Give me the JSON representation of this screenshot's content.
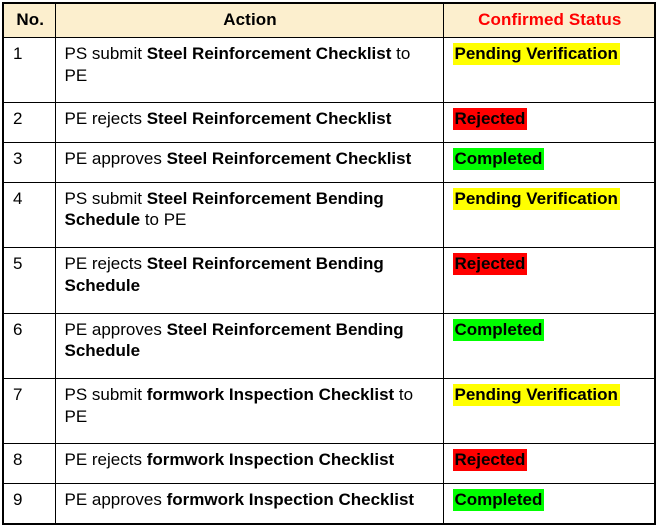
{
  "table": {
    "columns": [
      {
        "key": "no",
        "label": "No."
      },
      {
        "key": "action",
        "label": "Action"
      },
      {
        "key": "status",
        "label": "Confirmed Status"
      }
    ],
    "header_background": "#FCEFCE",
    "header_status_color": "#FF0000",
    "status_colors": {
      "pending": "#FFFF00",
      "rejected": "#FF0000",
      "completed": "#00FF00"
    },
    "rows": [
      {
        "no": "1",
        "action_prefix": "PS submit ",
        "action_bold": "Steel Reinforcement Checklist",
        "action_suffix": " to PE",
        "status": "Pending Verification",
        "status_kind": "pending"
      },
      {
        "no": "2",
        "action_prefix": "PE rejects ",
        "action_bold": "Steel Reinforcement Checklist",
        "action_suffix": "",
        "status": "Rejected",
        "status_kind": "rejected"
      },
      {
        "no": "3",
        "action_prefix": "PE approves ",
        "action_bold": "Steel Reinforcement Checklist",
        "action_suffix": "",
        "status": "Completed",
        "status_kind": "completed"
      },
      {
        "no": "4",
        "action_prefix": "PS submit ",
        "action_bold": "Steel Reinforcement Bending Schedule",
        "action_suffix": " to PE",
        "status": "Pending Verification",
        "status_kind": "pending"
      },
      {
        "no": "5",
        "action_prefix": "PE rejects ",
        "action_bold": "Steel Reinforcement Bending Schedule",
        "action_suffix": "",
        "status": "Rejected",
        "status_kind": "rejected"
      },
      {
        "no": "6",
        "action_prefix": "PE approves ",
        "action_bold": "Steel Reinforcement Bending Schedule",
        "action_suffix": "",
        "status": "Completed",
        "status_kind": "completed"
      },
      {
        "no": "7",
        "action_prefix": "PS submit ",
        "action_bold": "formwork Inspection Checklist",
        "action_suffix": " to PE",
        "status": "Pending Verification",
        "status_kind": "pending"
      },
      {
        "no": "8",
        "action_prefix": "PE rejects ",
        "action_bold": "formwork Inspection Checklist",
        "action_suffix": "",
        "status": "Rejected",
        "status_kind": "rejected"
      },
      {
        "no": "9",
        "action_prefix": "PE approves ",
        "action_bold": "formwork Inspection Checklist",
        "action_suffix": "",
        "status": "Completed",
        "status_kind": "completed"
      }
    ]
  }
}
